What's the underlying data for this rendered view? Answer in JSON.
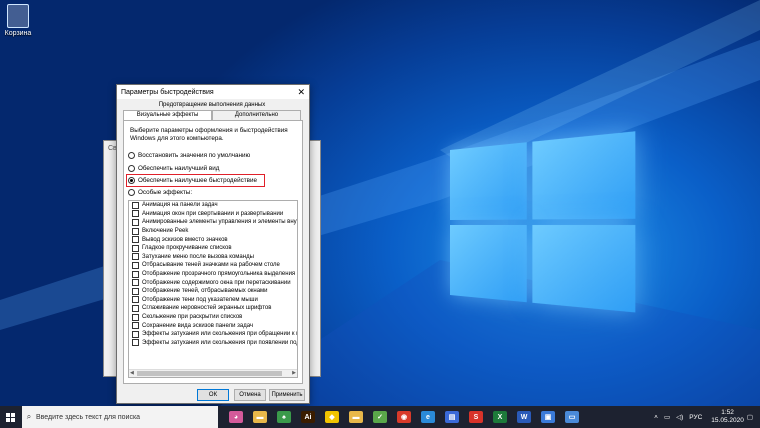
{
  "desktop": {
    "recycle_bin_label": "Корзина",
    "colors": {
      "accent": "#0a5fc8",
      "highlight_border": "#e0202a"
    }
  },
  "dialog": {
    "title": "Параметры быстродействия",
    "tab_top": "Предотвращение выполнения данных",
    "tabs": [
      "Визуальные эффекты",
      "Дополнительно"
    ],
    "description": "Выберите параметры оформления и быстродействия Windows для этого компьютера.",
    "radios": [
      {
        "label": "Восстановить значения по умолчанию",
        "selected": false
      },
      {
        "label": "Обеспечить наилучший вид",
        "selected": false
      },
      {
        "label": "Обеспечить наилучшее быстродействие",
        "selected": true
      },
      {
        "label": "Особые эффекты:",
        "selected": false
      }
    ],
    "effects": [
      "Анимация на панели задач",
      "Анимация окон при свертывании и развертывании",
      "Анимированные элементы управления и элементы внут",
      "Включение Peek",
      "Вывод эскизов вместо значков",
      "Гладкое прокручивание списков",
      "Затухание меню после вызова команды",
      "Отбрасывание теней значками на рабочем столе",
      "Отображение прозрачного прямоугольника выделения",
      "Отображение содержимого окна при перетаскивании",
      "Отображение теней, отбрасываемых окнами",
      "Отображение тени под указателем мыши",
      "Сглаживание неровностей экранных шрифтов",
      "Скольжение при раскрытии списков",
      "Сохранение вида эскизов панели задач",
      "Эффекты затухания или скольжения при обращении к ме",
      "Эффекты затухания или скольжения при появлении подс"
    ],
    "buttons": {
      "ok": "ОК",
      "cancel": "Отмена",
      "apply": "Применить"
    }
  },
  "taskbar": {
    "search_placeholder": "Введите здесь текст для поиска",
    "language": "РУС",
    "time": "1:52",
    "date": "15.05.2020",
    "apps": [
      {
        "name": "mixed-reality-icon",
        "glyph": "◕",
        "color": "#d45a9a"
      },
      {
        "name": "explorer-icon",
        "glyph": "▬",
        "color": "#e8b84a"
      },
      {
        "name": "games-icon",
        "glyph": "♠",
        "color": "#3a9a4a"
      },
      {
        "name": "illustrator-icon",
        "glyph": "Ai",
        "color": "#3a1d00"
      },
      {
        "name": "norton-icon",
        "glyph": "◆",
        "color": "#f0c400"
      },
      {
        "name": "folder-icon",
        "glyph": "▬",
        "color": "#e8b84a"
      },
      {
        "name": "torrent-icon",
        "glyph": "✓",
        "color": "#5aa84a"
      },
      {
        "name": "record-icon",
        "glyph": "◉",
        "color": "#d83a2a"
      },
      {
        "name": "edge-icon",
        "glyph": "e",
        "color": "#2a8ad8"
      },
      {
        "name": "store-icon",
        "glyph": "▤",
        "color": "#3a6ad8"
      },
      {
        "name": "pdf-icon",
        "glyph": "S",
        "color": "#d8332a"
      },
      {
        "name": "excel-icon",
        "glyph": "X",
        "color": "#1d7a3a"
      },
      {
        "name": "word-icon",
        "glyph": "W",
        "color": "#2a5ab8"
      },
      {
        "name": "photos-icon",
        "glyph": "▣",
        "color": "#3a7ad8"
      },
      {
        "name": "settings-window-icon",
        "glyph": "▭",
        "color": "#4a8ad8"
      }
    ]
  }
}
